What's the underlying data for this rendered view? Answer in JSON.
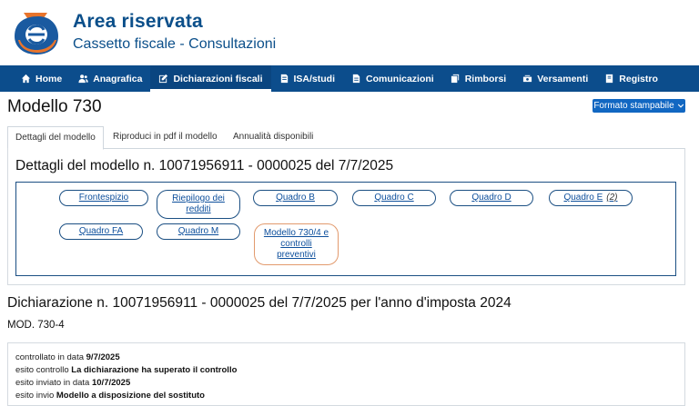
{
  "header": {
    "title": "Area riservata",
    "subtitle": "Cassetto fiscale - Consultazioni"
  },
  "nav": [
    {
      "label": "Home",
      "icon": "home-icon"
    },
    {
      "label": "Anagrafica",
      "icon": "users-icon"
    },
    {
      "label": "Dichiarazioni fiscali",
      "icon": "edit-icon",
      "active": true
    },
    {
      "label": "ISA/studi",
      "icon": "file-icon"
    },
    {
      "label": "Comunicazioni",
      "icon": "document-icon"
    },
    {
      "label": "Rimborsi",
      "icon": "copy-icon"
    },
    {
      "label": "Versamenti",
      "icon": "money-icon"
    },
    {
      "label": "Registro",
      "icon": "book-icon"
    }
  ],
  "page": {
    "title": "Modello 730",
    "print_button": "Formato stampabile"
  },
  "tabs": [
    {
      "label": "Dettagli del modello",
      "active": true
    },
    {
      "label": "Riproduci in pdf il modello"
    },
    {
      "label": "Annualità disponibili"
    }
  ],
  "details": {
    "title": "Dettagli del modello n. 10071956911 - 0000025 del 7/7/2025",
    "buttons": {
      "frontespizio": "Frontespizio",
      "riepilogo_line1": "Riepilogo dei",
      "riepilogo_line2": "redditi",
      "quadro_b": "Quadro B",
      "quadro_c": "Quadro C",
      "quadro_d": "Quadro D",
      "quadro_e": "Quadro E",
      "quadro_e_count": "(2)",
      "quadro_fa": "Quadro FA",
      "quadro_m": "Quadro M",
      "modello_line1": "Modello 730/4 e",
      "modello_line2": "controlli",
      "modello_line3": "preventivi"
    }
  },
  "declaration": {
    "title": "Dichiarazione n. 10071956911 - 0000025 del 7/7/2025 per l'anno d'imposta 2024",
    "mod": "MOD. 730-4",
    "lines": [
      {
        "label": "controllato in data",
        "value": "9/7/2025"
      },
      {
        "label": "esito controllo",
        "value": "La dichiarazione ha superato il controllo"
      },
      {
        "label": "esito inviato in data",
        "value": "10/7/2025"
      },
      {
        "label": "esito invio",
        "value": "Modello a disposizione del sostituto"
      }
    ]
  },
  "colors": {
    "brand_blue": "#0c4d8c",
    "link_blue": "#0d4f9c",
    "button_blue": "#1167c2",
    "highlight_orange": "#e29a6d"
  }
}
